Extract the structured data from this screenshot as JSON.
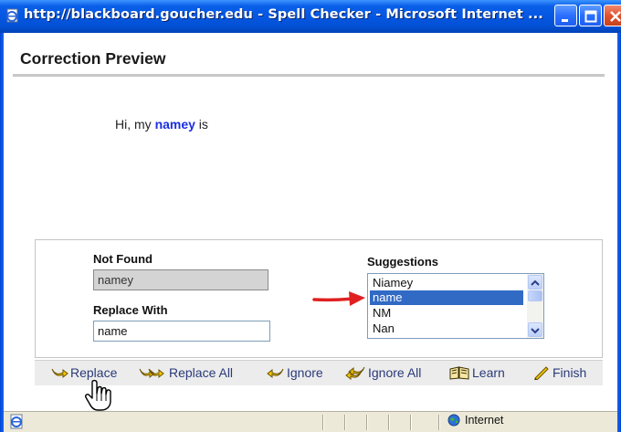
{
  "window": {
    "title": "http://blackboard.goucher.edu - Spell Checker - Microsoft Internet ..."
  },
  "page": {
    "heading": "Correction Preview"
  },
  "preview": {
    "text_before": "Hi, my ",
    "misspelled_word": "namey",
    "text_after": " is"
  },
  "form": {
    "not_found_label": "Not Found",
    "not_found_value": "namey",
    "replace_with_label": "Replace With",
    "replace_with_value": "name",
    "suggestions_label": "Suggestions",
    "suggestions": [
      "Niamey",
      "name",
      "NM",
      "Nan"
    ],
    "selected_suggestion": "name"
  },
  "toolbar": {
    "replace": "Replace",
    "replace_all": "Replace All",
    "ignore": "Ignore",
    "ignore_all": "Ignore All",
    "learn": "Learn",
    "finish": "Finish"
  },
  "statusbar": {
    "zone": "Internet"
  },
  "colors": {
    "titlebar": "#0457e3",
    "misspelled": "#1a2fe0",
    "selection": "#316ac5",
    "arrow": "#e02020"
  },
  "icons": [
    "ie-page-icon",
    "minimize-icon",
    "maximize-icon",
    "close-icon",
    "replace-icon",
    "replace-all-icon",
    "ignore-icon",
    "ignore-all-icon",
    "learn-icon",
    "finish-icon",
    "hand-cursor-icon",
    "globe-icon"
  ]
}
